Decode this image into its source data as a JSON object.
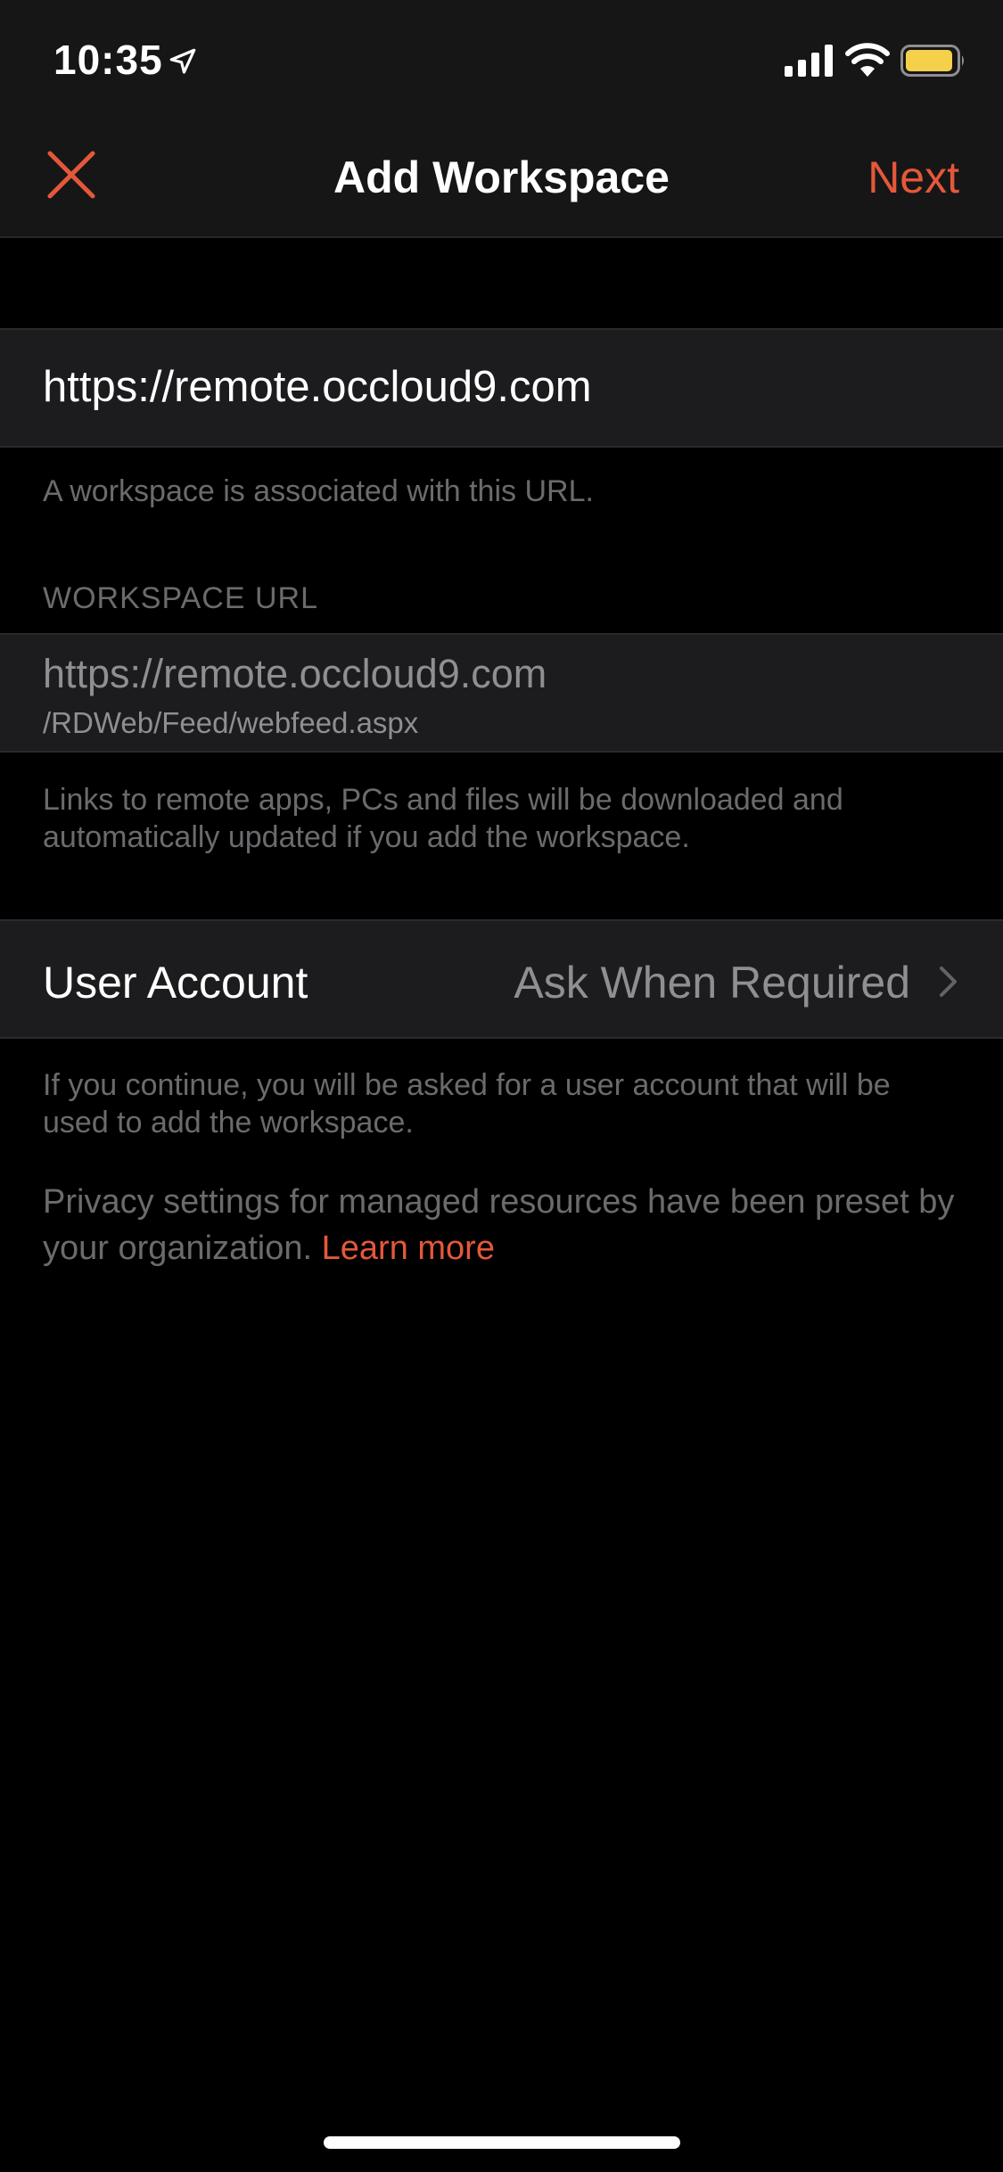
{
  "status_bar": {
    "time": "10:35",
    "battery_color": "#f5d04a"
  },
  "nav": {
    "title": "Add Workspace",
    "next_label": "Next",
    "accent_color": "#e4583a"
  },
  "url_input": {
    "value": "https://remote.occloud9.com",
    "helper": "A workspace is associated with this URL."
  },
  "workspace_url": {
    "header": "WORKSPACE URL",
    "url_main": "https://remote.occloud9.com",
    "url_path": "/RDWeb/Feed/webfeed.aspx",
    "footer": "Links to remote apps, PCs and files will be downloaded and automatically updated if you add the workspace."
  },
  "user_account": {
    "label": "User Account",
    "value": "Ask When Required",
    "footer": "If you continue, you will be asked for a user account that will be used to add the workspace."
  },
  "privacy": {
    "text": "Privacy settings for managed resources have been preset by your organization.",
    "link_label": "Learn more"
  }
}
